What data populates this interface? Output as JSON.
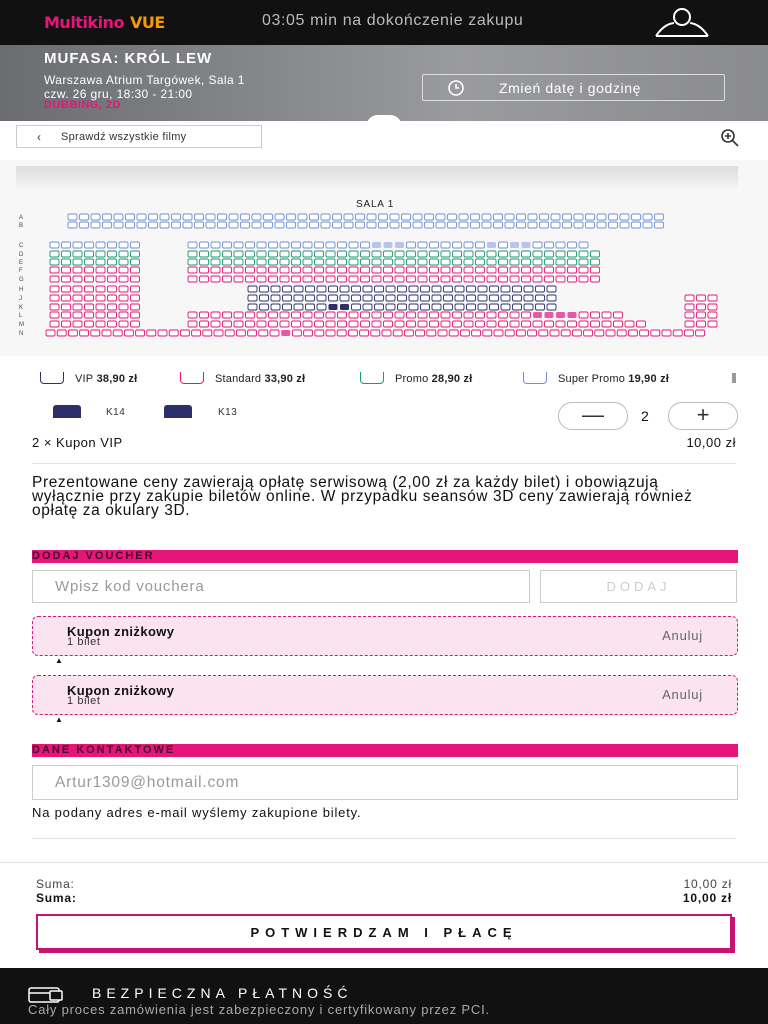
{
  "header": {
    "logo_main": "Multikino",
    "logo_partner": "VUE",
    "timer": "03:05 min na dokończenie zakupu"
  },
  "movie": {
    "title": "MUFASA: KRÓL LEW",
    "cinema": "Warszawa Atrium Targówek, Sala 1",
    "datetime": "czw. 26 gru, 18:30 - 21:00",
    "format": "DUBBING, 2D",
    "change_label": "Zmień datę i godzinę"
  },
  "nav": {
    "back_label": "Sprawdź wszystkie filmy"
  },
  "hall": {
    "name": "SALA 1",
    "rows": [
      "A",
      "B",
      "C",
      "D",
      "E",
      "F",
      "G",
      "H",
      "J",
      "K",
      "L",
      "M",
      "N"
    ]
  },
  "legend": [
    {
      "label": "VIP",
      "price": "38,90 zł",
      "color": "#2c2f6c"
    },
    {
      "label": "Standard",
      "price": "33,90 zł",
      "color": "#e5157a"
    },
    {
      "label": "Promo",
      "price": "28,90 zł",
      "color": "#1a9a6c"
    },
    {
      "label": "Super Promo",
      "price": "19,90 zł",
      "color": "#6f8fd6"
    }
  ],
  "selection": {
    "seats": [
      "K14",
      "K13"
    ],
    "quantity": "2"
  },
  "ticket": {
    "line": "2 × Kupon VIP",
    "price": "10,00 zł"
  },
  "info": "Prezentowane ceny zawierają opłatę serwisową (2,00 zł za każdy bilet) i obowiązują wyłącznie przy zakupie biletów online. W przypadku seansów 3D ceny zawierają również opłatę za okulary 3D.",
  "voucher": {
    "heading": "DODAJ VOUCHER",
    "placeholder": "Wpisz kod vouchera",
    "button": "DODAJ"
  },
  "coupons": [
    {
      "title": "Kupon zniżkowy",
      "sub": "1 bilet",
      "action": "Anuluj"
    },
    {
      "title": "Kupon zniżkowy",
      "sub": "1 bilet",
      "action": "Anuluj"
    }
  ],
  "contact": {
    "heading": "DANE KONTAKTOWE",
    "email": "Artur1309@hotmail.com",
    "note": "Na podany adres e-mail wyślemy zakupione bilety."
  },
  "summary": {
    "label1": "Suma:",
    "value1": "10,00 zł",
    "label2": "Suma:",
    "value2": "10,00 zł",
    "confirm": "POTWIERDZAM I PŁACĘ"
  },
  "footer": {
    "heading": "BEZPIECZNA PŁATNOŚĆ",
    "text": "Cały proces zamówienia jest zabezpieczony i certyfikowany przez PCI."
  }
}
